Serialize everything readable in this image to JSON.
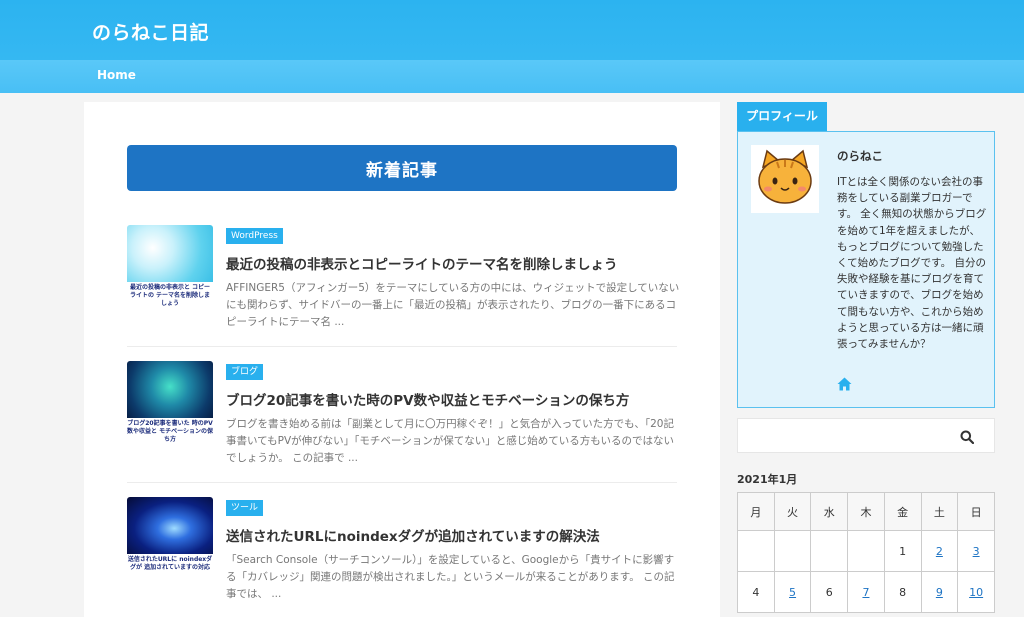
{
  "header": {
    "site_title": "のらねこ日記"
  },
  "nav": {
    "home": "Home"
  },
  "main": {
    "section_heading": "新着記事",
    "posts": [
      {
        "category": "WordPress",
        "title": "最近の投稿の非表示とコピーライトのテーマ名を削除しましょう",
        "excerpt": "AFFINGER5（アフィンガー5）をテーマにしている方の中には、ウィジェットで設定していないにも関わらず、サイドバーの一番上に「最近の投稿」が表示されたり、ブログの一番下にあるコピーライトにテーマ名 ...",
        "thumb_caption": "最近の投稿の非表示と コピーライトの テーマ名を削除しましょう"
      },
      {
        "category": "ブログ",
        "title": "ブログ20記事を書いた時のPV数や収益とモチベーションの保ち方",
        "excerpt": "ブログを書き始める前は「副業として月に〇万円稼ぐぞ！」と気合が入っていた方でも、「20記事書いてもPVが伸びない」「モチベーションが保てない」と感じ始めている方もいるのではないでしょうか。 この記事で ...",
        "thumb_caption": "ブログ20記事を書いた 時のPV数や収益と モチベーションの保ち方"
      },
      {
        "category": "ツール",
        "title": "送信されたURLにnoindexダグが追加されていますの解決法",
        "excerpt": "「Search Console（サーチコンソール）」を設定していると、Googleから「貴サイトに影響する「カバレッジ」関連の問題が検出されました。」というメールが来ることがあります。 この記事では、 ...",
        "thumb_caption": "送信されたURLに noindexダグが 追加されていますの対応"
      }
    ]
  },
  "sidebar": {
    "profile_tab": "プロフィール",
    "profile_name": "のらねこ",
    "profile_text": "ITとは全く関係のない会社の事務をしている副業ブロガーです。 全く無知の状態からブログを始めて1年を超えましたが、もっとブログについて勉強したくて始めたブログです。 自分の失敗や経験を基にブログを育てていきますので、ブログを始めて間もない方や、これから始めようと思っている方は一緒に頑張ってみませんか？",
    "calendar": {
      "caption": "2021年1月",
      "weekdays": [
        "月",
        "火",
        "水",
        "木",
        "金",
        "土",
        "日"
      ],
      "row1": [
        "",
        "",
        "",
        "",
        "1",
        "2",
        "3"
      ],
      "row2": [
        "4",
        "5",
        "6",
        "7",
        "8",
        "9",
        "10"
      ]
    }
  },
  "colors": {
    "accent": "#29b0ee",
    "heading": "#1e74c4",
    "profile_bg": "#e1f3fc"
  },
  "icons": {
    "home": "home-icon",
    "search": "search-icon",
    "avatar": "cat-face-icon"
  }
}
